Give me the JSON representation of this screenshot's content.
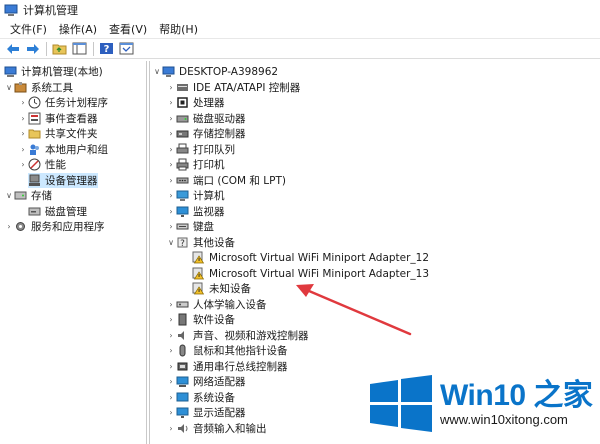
{
  "window": {
    "title": "计算机管理"
  },
  "menu": [
    "文件(F)",
    "操作(A)",
    "查看(V)",
    "帮助(H)"
  ],
  "toolbar": {
    "buttons": [
      "back-icon",
      "forward-icon",
      "folder-up-icon",
      "show-hide-tree-icon",
      "help-icon",
      "properties-icon"
    ]
  },
  "left_tree": {
    "root": "计算机管理(本地)",
    "system_tools": "系统工具",
    "task_scheduler": "任务计划程序",
    "event_viewer": "事件查看器",
    "shared_folders": "共享文件夹",
    "local_users": "本地用户和组",
    "performance": "性能",
    "device_manager": "设备管理器",
    "storage": "存储",
    "disk_management": "磁盘管理",
    "services": "服务和应用程序"
  },
  "devices": {
    "computer_name": "DESKTOP-A398962",
    "categories": [
      "IDE ATA/ATAPI 控制器",
      "处理器",
      "磁盘驱动器",
      "存储控制器",
      "打印队列",
      "打印机",
      "端口 (COM 和 LPT)",
      "计算机",
      "监视器",
      "键盘",
      "其他设备"
    ],
    "other_devices": [
      "Microsoft Virtual WiFi Miniport Adapter_12",
      "Microsoft Virtual WiFi Miniport Adapter_13",
      "未知设备"
    ],
    "categories_after": [
      "人体学输入设备",
      "软件设备",
      "声音、视频和游戏控制器",
      "鼠标和其他指针设备",
      "通用串行总线控制器",
      "网络适配器",
      "系统设备",
      "显示适配器",
      "音频输入和输出"
    ]
  },
  "watermark": {
    "title": "Win10 之家",
    "url": "www.win10xitong.com"
  },
  "colors": {
    "selection": "#cce8ff",
    "brand_blue": "#0a74c9",
    "arrow_red": "#e0393e"
  }
}
